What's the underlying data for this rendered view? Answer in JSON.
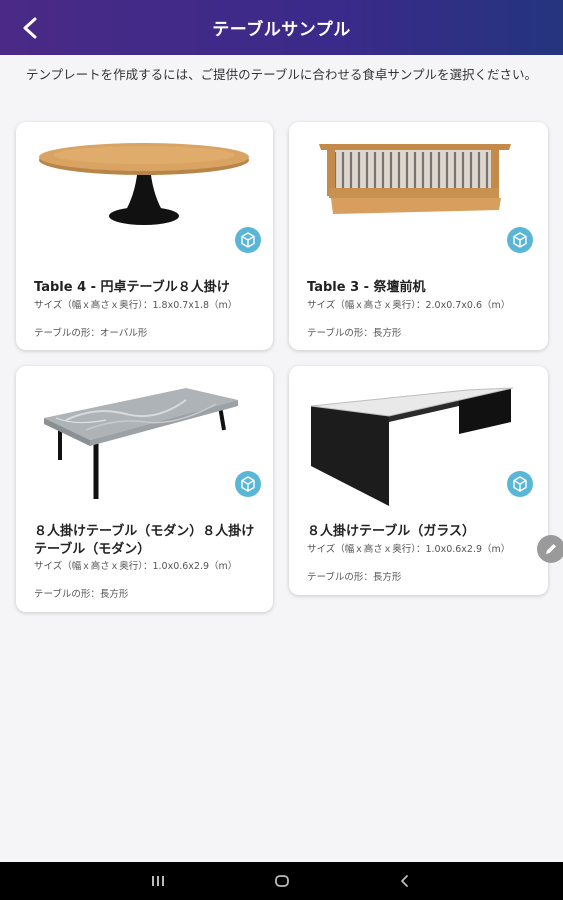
{
  "header": {
    "title": "テーブルサンプル"
  },
  "instruction": "テンプレートを作成するには、ご提供のテーブルに合わせる食卓サンプルを選択ください。",
  "cards": [
    {
      "title": "Table 4 - 円卓テーブル８人掛け",
      "size": "サイズ（幅ｘ高さｘ奥行）：1.8x0.7x1.8（m）",
      "shape": "テーブルの形：オーバル形",
      "icon": "cube-3d-icon"
    },
    {
      "title": "Table 3 - 祭壇前机",
      "size": "サイズ（幅ｘ高さｘ奥行）：2.0x0.7x0.6（m）",
      "shape": "テーブルの形：長方形",
      "icon": "cube-3d-icon"
    },
    {
      "title": "８人掛けテーブル（モダン）８人掛けテーブル（モダン）",
      "size": "サイズ（幅ｘ高さｘ奥行）：1.0x0.6x2.9（m）",
      "shape": "テーブルの形：長方形",
      "icon": "cube-3d-icon"
    },
    {
      "title": "８人掛けテーブル（ガラス）",
      "size": "サイズ（幅ｘ高さｘ奥行）：1.0x0.6x2.9（m）",
      "shape": "テーブルの形：長方形",
      "icon": "cube-3d-icon"
    }
  ],
  "colors": {
    "header_start": "#4a2a86",
    "header_end": "#24357e",
    "ar_icon": "#5ab6d6"
  }
}
